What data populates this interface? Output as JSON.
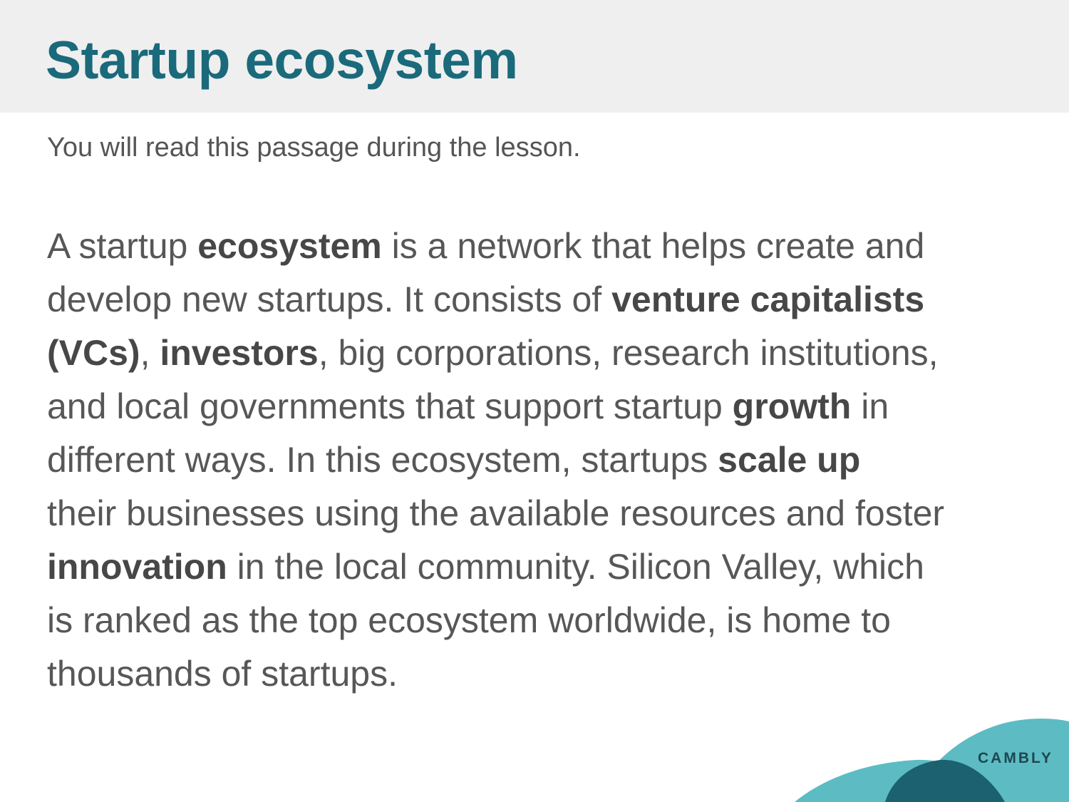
{
  "slide": {
    "title": "Startup ecosystem",
    "subtitle": "You will read this passage during the lesson."
  },
  "passage": {
    "lines": [
      [
        {
          "text": "A startup ",
          "bold": false
        },
        {
          "text": "ecosystem",
          "bold": true
        },
        {
          "text": " is a network that helps create and",
          "bold": false
        }
      ],
      [
        {
          "text": "develop new startups. It consists of ",
          "bold": false
        },
        {
          "text": "venture capitalists",
          "bold": true
        }
      ],
      [
        {
          "text": "(VCs)",
          "bold": true
        },
        {
          "text": ", ",
          "bold": false
        },
        {
          "text": "investors",
          "bold": true
        },
        {
          "text": ", big corporations, research institutions,",
          "bold": false
        }
      ],
      [
        {
          "text": "and local governments that support startup ",
          "bold": false
        },
        {
          "text": "growth",
          "bold": true
        },
        {
          "text": " in",
          "bold": false
        }
      ],
      [
        {
          "text": "different ways. In this ecosystem, startups ",
          "bold": false
        },
        {
          "text": "scale up",
          "bold": true
        }
      ],
      [
        {
          "text": "their businesses using the available resources and foster",
          "bold": false
        }
      ],
      [
        {
          "text": "innovation",
          "bold": true
        },
        {
          "text": " in the local community. Silicon Valley, which",
          "bold": false
        }
      ],
      [
        {
          "text": "is ranked as the top ecosystem worldwide, is home to",
          "bold": false
        }
      ],
      [
        {
          "text": "thousands of startups.",
          "bold": false
        }
      ]
    ]
  },
  "branding": {
    "logo_text": "CAMBLY",
    "colors": {
      "header_bg": "#efefef",
      "title": "#1a6a7b",
      "wave_light": "#5dbcc3",
      "wave_dark": "#1b6170"
    }
  }
}
